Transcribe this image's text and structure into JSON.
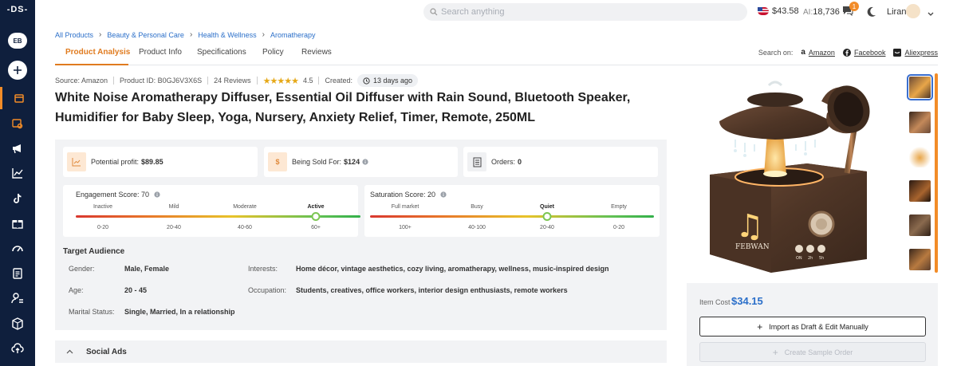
{
  "app": {
    "logo": "-DS-",
    "workspace_badge": "EB"
  },
  "topbar": {
    "search_placeholder": "Search anything",
    "balance": "$43.58",
    "ai_prefix": "AI:",
    "ai_credits": "18,736",
    "messages_count": "1",
    "user_name": "Liran"
  },
  "sidebar": {
    "items": [
      {
        "icon": "store-icon",
        "active": true
      },
      {
        "icon": "products-search-icon"
      },
      {
        "icon": "megaphone-icon"
      },
      {
        "icon": "chart-icon"
      },
      {
        "icon": "tiktok-icon"
      },
      {
        "icon": "gift-icon"
      },
      {
        "icon": "gauge-icon"
      },
      {
        "icon": "document-icon"
      },
      {
        "icon": "user-settings-icon"
      },
      {
        "icon": "box-icon"
      },
      {
        "icon": "cloud-upload-icon"
      }
    ]
  },
  "breadcrumb": [
    "All Products",
    "Beauty & Personal Care",
    "Health & Wellness",
    "Aromatherapy"
  ],
  "tabs": [
    {
      "label": "Product Analysis",
      "active": true
    },
    {
      "label": "Product Info"
    },
    {
      "label": "Specifications"
    },
    {
      "label": "Policy"
    },
    {
      "label": "Reviews"
    }
  ],
  "search_on": {
    "label": "Search on:",
    "amazon": "Amazon",
    "facebook": "Facebook",
    "aliexpress": "Aliexpress"
  },
  "meta": {
    "source": "Source: Amazon",
    "product_id": "Product ID: B0GJ6V3X6S",
    "reviews": "24 Reviews",
    "stars": "★★★★★",
    "rating": "4.5",
    "created_label": "Created:",
    "created_value": "13 days ago"
  },
  "product_title": "White Noise Aromatherapy Diffuser, Essential Oil Diffuser with Rain Sound, Bluetooth Speaker, Humidifier for Baby Sleep, Yoga, Nursery, Anxiety Relief, Timer, Remote, 250ML",
  "stats": {
    "profit_label": "Potential profit:",
    "profit_value": "$89.85",
    "sold_label": "Being Sold For:",
    "sold_value": "$124",
    "orders_label": "Orders:",
    "orders_value": "0"
  },
  "engagement": {
    "title": "Engagement Score: 70",
    "score": 70,
    "labels": [
      "Inactive",
      "Mild",
      "Moderate",
      "Active"
    ],
    "ranges": [
      "0-20",
      "20-40",
      "40-60",
      "60+"
    ],
    "selected_index": 3
  },
  "saturation": {
    "title": "Saturation Score: 20",
    "score": 20,
    "labels": [
      "Full market",
      "Busy",
      "Quiet",
      "Empty"
    ],
    "ranges": [
      "100+",
      "40-100",
      "20-40",
      "0-20"
    ],
    "selected_index": 2
  },
  "target_audience": {
    "title": "Target Audience",
    "gender_label": "Gender:",
    "gender": "Male, Female",
    "age_label": "Age:",
    "age": "20 - 45",
    "marital_label": "Marital Status:",
    "marital": "Single, Married, In a relationship",
    "interests_label": "Interests:",
    "interests": "Home décor, vintage aesthetics, cozy living, aromatherapy, wellness, music-inspired design",
    "occupation_label": "Occupation:",
    "occupation": "Students, creatives, office workers, interior design enthusiasts, remote workers"
  },
  "social_ads": {
    "label": "Social Ads"
  },
  "image_text": {
    "brand": "FEBWAN",
    "btn1": "ON",
    "btn2": "2h",
    "btn3": "5h"
  },
  "purchase": {
    "cost_label": "Item Cost",
    "cost_value": "$34.15",
    "import_label": "Import as Draft & Edit Manually",
    "sample_label": "Create Sample Order"
  },
  "colors": {
    "accent": "#e07b1f",
    "sidebar": "#0f1f3d",
    "link": "#2b6fc9"
  }
}
